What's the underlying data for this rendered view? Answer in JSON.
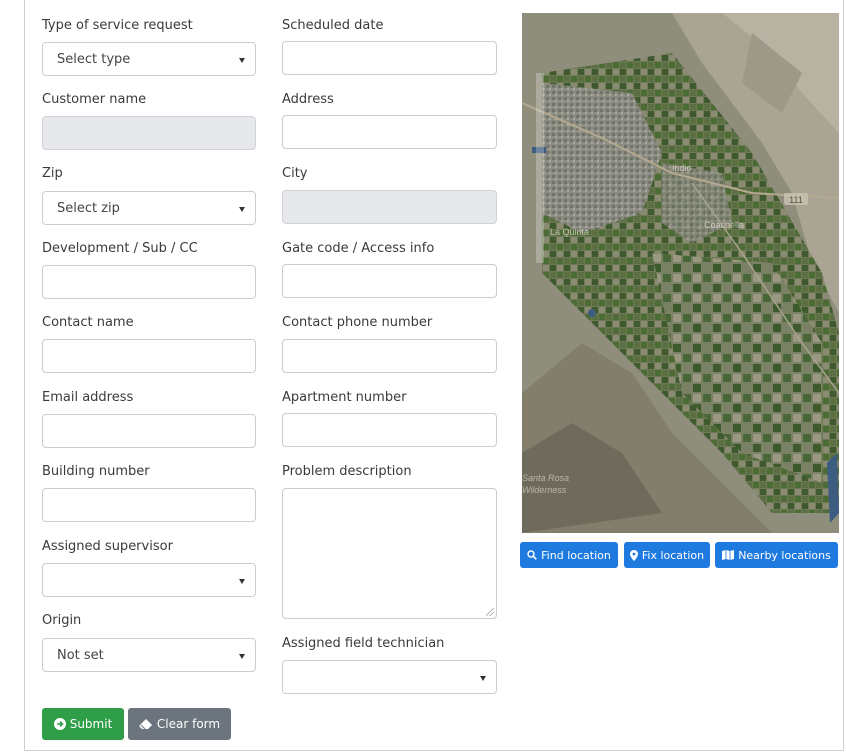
{
  "form": {
    "service_type": {
      "label": "Type of service request",
      "value": "Select type"
    },
    "scheduled_date": {
      "label": "Scheduled date",
      "value": ""
    },
    "customer_name": {
      "label": "Customer name",
      "value": ""
    },
    "address": {
      "label": "Address",
      "value": ""
    },
    "zip": {
      "label": "Zip",
      "value": "Select zip"
    },
    "city": {
      "label": "City",
      "value": ""
    },
    "development": {
      "label": "Development / Sub / CC",
      "value": ""
    },
    "gate_code": {
      "label": "Gate code / Access info",
      "value": ""
    },
    "contact_name": {
      "label": "Contact name",
      "value": ""
    },
    "contact_phone": {
      "label": "Contact phone number",
      "value": ""
    },
    "email": {
      "label": "Email address",
      "value": ""
    },
    "apartment": {
      "label": "Apartment number",
      "value": ""
    },
    "building": {
      "label": "Building number",
      "value": ""
    },
    "problem": {
      "label": "Problem description",
      "value": ""
    },
    "supervisor": {
      "label": "Assigned supervisor",
      "value": ""
    },
    "origin": {
      "label": "Origin",
      "value": "Not set"
    },
    "technician": {
      "label": "Assigned field technician",
      "value": ""
    }
  },
  "map": {
    "labels": [
      "Indio",
      "Coachella",
      "La Quinta",
      "Santa Rosa",
      "Wilderness"
    ],
    "route": "111"
  },
  "map_buttons": {
    "find": "Find location",
    "fix": "Fix location",
    "nearby": "Nearby locations"
  },
  "actions": {
    "submit": "Submit",
    "clear": "Clear form"
  },
  "colors": {
    "primary": "#1f7ae0",
    "success": "#2f9e48",
    "secondary": "#6c757d",
    "disabled_field": "#e6e8ec"
  }
}
